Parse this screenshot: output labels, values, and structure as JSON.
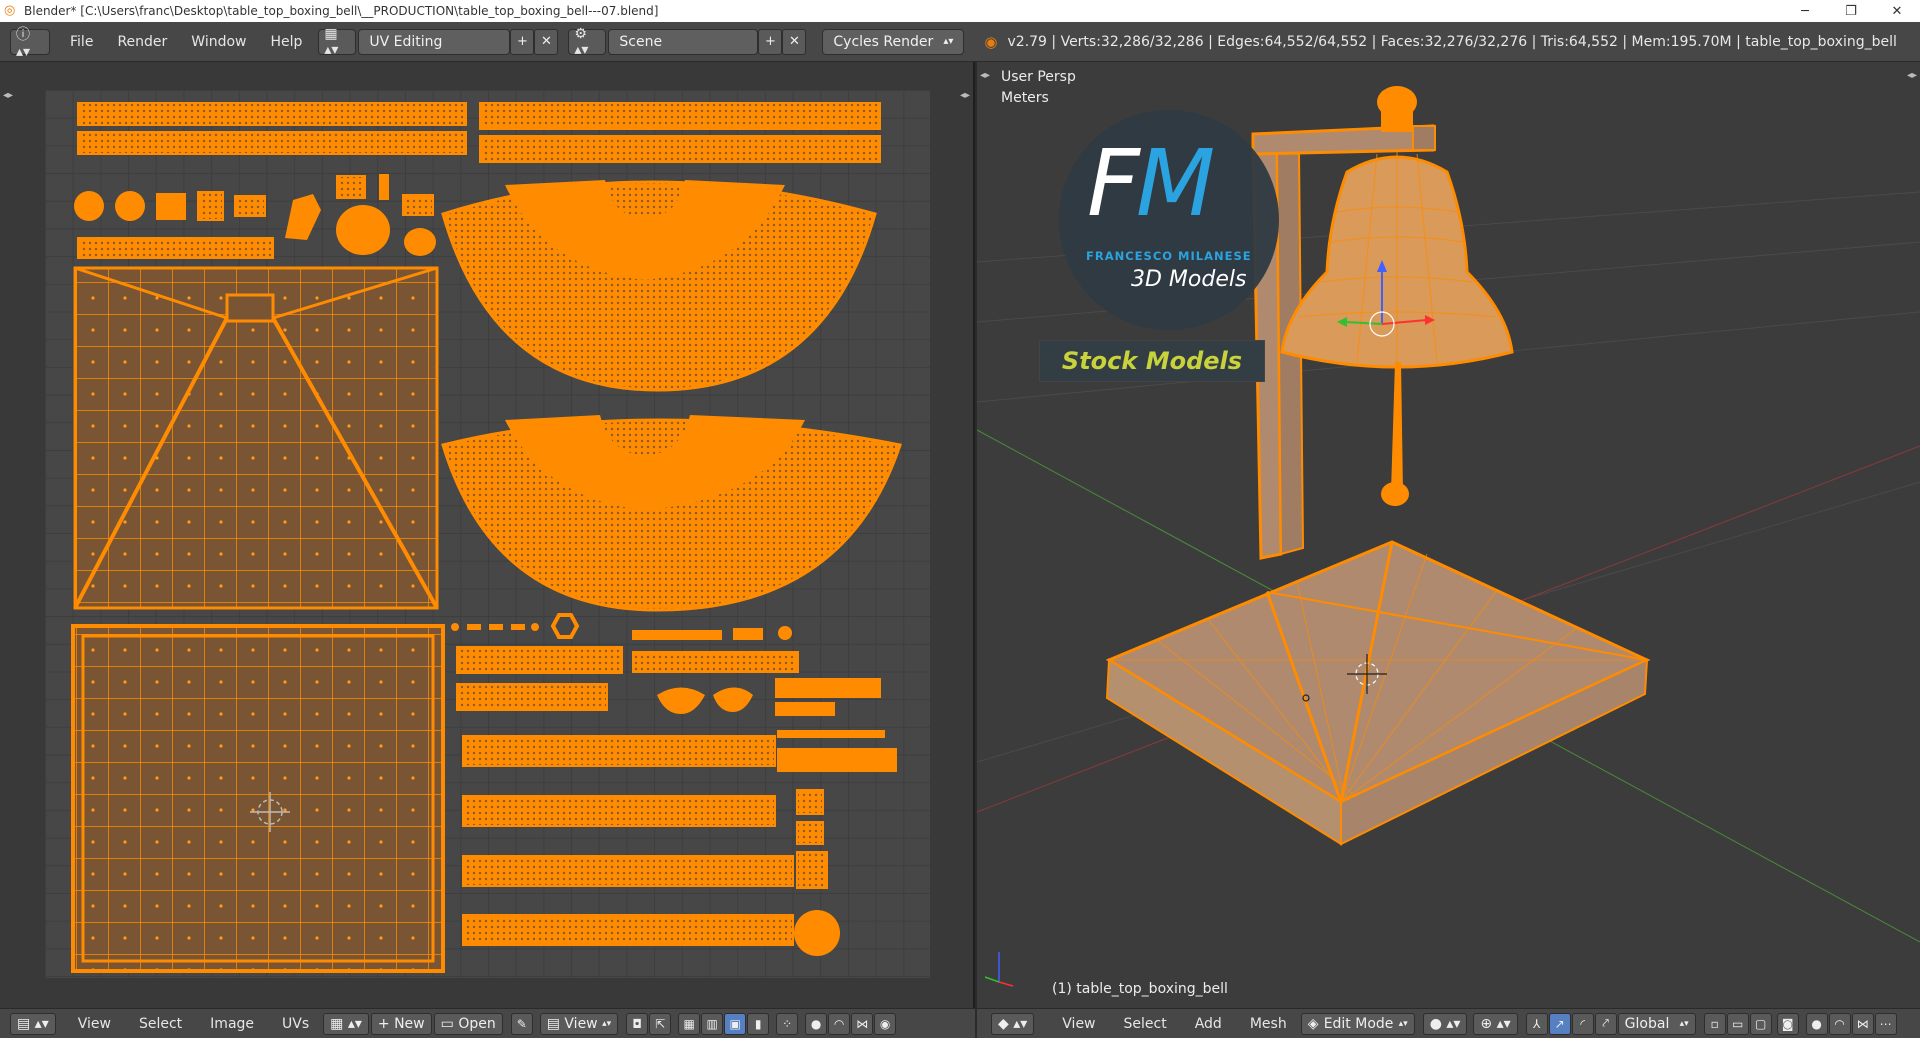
{
  "window": {
    "title": "Blender* [C:\\Users\\franc\\Desktop\\table_top_boxing_bell\\__PRODUCTION\\table_top_boxing_bell---07.blend]",
    "controls": [
      "─",
      "❐",
      "✕"
    ]
  },
  "infobar": {
    "menus": [
      "File",
      "Render",
      "Window",
      "Help"
    ],
    "screen_layout": "UV Editing",
    "scene": "Scene",
    "render_engine": "Cycles Render",
    "stats": "v2.79 | Verts:32,286/32,286 | Edges:64,552/64,552 | Faces:32,276/32,276 | Tris:64,552 | Mem:195.70M | table_top_boxing_bell"
  },
  "viewport": {
    "view_name": "User Persp",
    "units": "Meters",
    "object_label": "(1) table_top_boxing_bell"
  },
  "logo": {
    "letter_f": "F",
    "letter_m": "M",
    "name": "FRANCESCO MILANESE",
    "tagline": "3D Models",
    "stock": "Stock Models"
  },
  "uv_bottombar": {
    "menus": [
      "View",
      "Select",
      "Image",
      "UVs"
    ],
    "new_label": "New",
    "open_label": "Open",
    "view_label": "View"
  },
  "vp_bottombar": {
    "menus": [
      "View",
      "Select",
      "Add",
      "Mesh"
    ],
    "mode": "Edit Mode",
    "orientation": "Global"
  },
  "colors": {
    "accent": "#ff8c00",
    "header": "#474747",
    "logo_blue": "#2aa3e0",
    "stock_yellow": "#c8d23a"
  }
}
